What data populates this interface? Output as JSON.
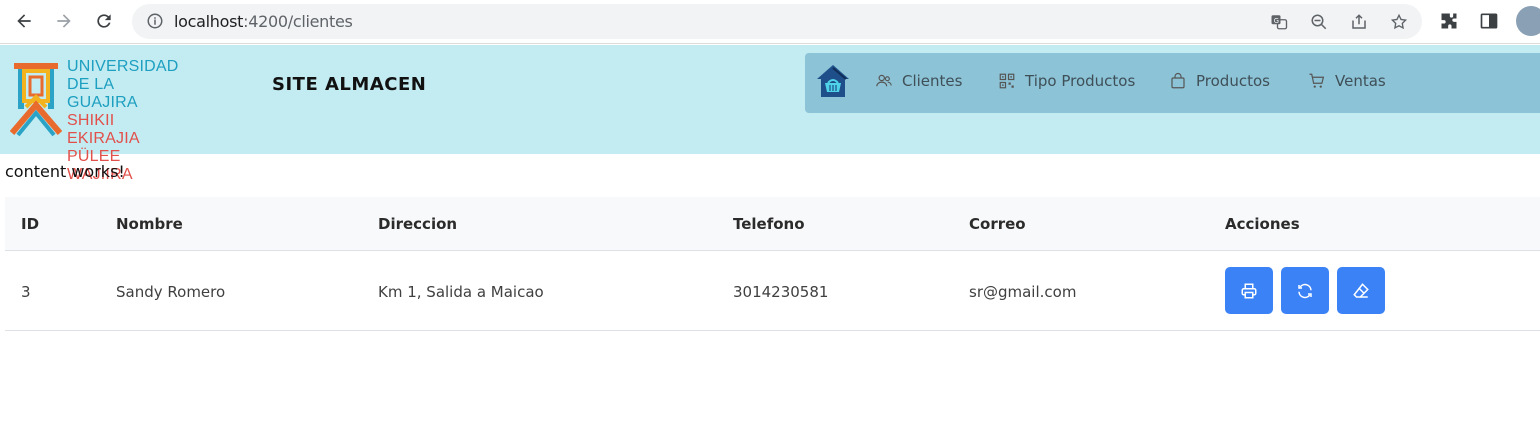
{
  "browser": {
    "url_host": "localhost",
    "url_path": ":4200/clientes"
  },
  "header": {
    "logo": {
      "line1": "UNIVERSIDAD",
      "line2": "DE LA GUAJIRA",
      "line3": "SHIKII EKIRAJIA",
      "line4": "PÜLEE WAJIIRA"
    },
    "site_title": "SITE ALMACEN",
    "menu": [
      {
        "label": "Clientes",
        "icon": "users-icon"
      },
      {
        "label": "Tipo Productos",
        "icon": "qr-icon"
      },
      {
        "label": "Productos",
        "icon": "bag-icon"
      },
      {
        "label": "Ventas",
        "icon": "cart-icon"
      }
    ]
  },
  "main": {
    "content_text": "content works!",
    "table": {
      "headers": [
        "ID",
        "Nombre",
        "Direccion",
        "Telefono",
        "Correo",
        "Acciones"
      ],
      "rows": [
        {
          "id": "3",
          "nombre": "Sandy Romero",
          "direccion": "Km 1, Salida a Maicao",
          "telefono": "3014230581",
          "correo": "sr@gmail.com"
        }
      ],
      "actions": [
        "print-icon",
        "refresh-icon",
        "eraser-icon"
      ]
    }
  },
  "colors": {
    "header_bg": "#c2ebf2",
    "menu_bg": "#8cc3d6",
    "action_button": "#3b82f6"
  }
}
